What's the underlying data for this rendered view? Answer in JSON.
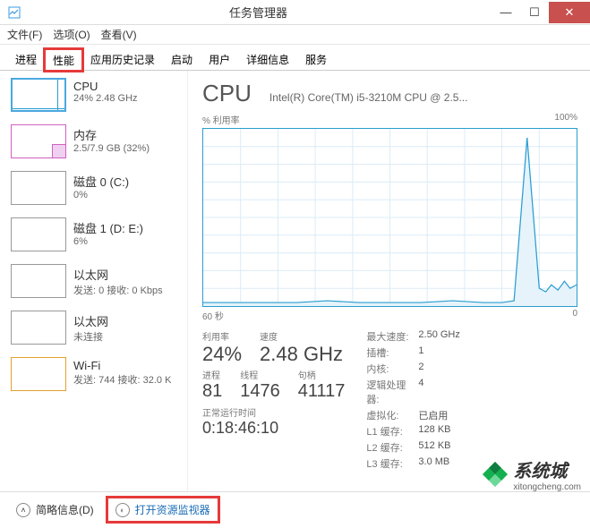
{
  "titlebar": {
    "title": "任务管理器"
  },
  "menu": {
    "file": "文件(F)",
    "options": "选项(O)",
    "view": "查看(V)"
  },
  "tabs": {
    "processes": "进程",
    "performance": "性能",
    "history": "应用历史记录",
    "startup": "启动",
    "users": "用户",
    "details": "详细信息",
    "services": "服务"
  },
  "sidebar": [
    {
      "name": "CPU",
      "sub": "24% 2.48 GHz"
    },
    {
      "name": "内存",
      "sub": "2.5/7.9 GB (32%)"
    },
    {
      "name": "磁盘 0 (C:)",
      "sub": "0%"
    },
    {
      "name": "磁盘 1 (D: E:)",
      "sub": "6%"
    },
    {
      "name": "以太网",
      "sub": "发送: 0 接收: 0 Kbps"
    },
    {
      "name": "以太网",
      "sub": "未连接"
    },
    {
      "name": "Wi-Fi",
      "sub": "发送: 744 接收: 32.0 K"
    }
  ],
  "cpu": {
    "title": "CPU",
    "model": "Intel(R) Core(TM) i5-3210M CPU @ 2.5...",
    "util_label": "% 利用率",
    "max_label": "100%",
    "time_label": "60 秒",
    "zero_label": "0",
    "labels": {
      "util": "利用率",
      "speed": "速度",
      "proc": "进程",
      "threads": "线程",
      "handles": "句柄",
      "maxspeed": "最大速度:",
      "sockets": "插槽:",
      "cores": "内核:",
      "lprocs": "逻辑处理器:",
      "virt": "虚拟化:",
      "l1": "L1 缓存:",
      "l2": "L2 缓存:",
      "l3": "L3 缓存:",
      "uptime": "正常运行时间"
    },
    "vals": {
      "util": "24%",
      "speed": "2.48 GHz",
      "proc": "81",
      "threads": "1476",
      "handles": "41117",
      "maxspeed": "2.50 GHz",
      "sockets": "1",
      "cores": "2",
      "lprocs": "4",
      "virt": "已启用",
      "l1": "128 KB",
      "l2": "512 KB",
      "l3": "3.0 MB",
      "uptime": "0:18:46:10"
    }
  },
  "footer": {
    "less": "简略信息(D)",
    "resmon": "打开资源监视器"
  },
  "watermark": {
    "text": "系统城",
    "url": "xitongcheng.com"
  },
  "chart_data": {
    "type": "line",
    "title": "% 利用率",
    "xlabel": "60 秒",
    "ylabel": "",
    "ylim": [
      0,
      100
    ],
    "x": [
      0,
      5,
      10,
      15,
      20,
      25,
      30,
      35,
      40,
      45,
      48,
      50,
      52,
      54,
      55,
      56,
      57,
      58,
      59,
      60
    ],
    "values": [
      2,
      2,
      2,
      2,
      3,
      2,
      2,
      2,
      3,
      2,
      2,
      3,
      95,
      10,
      8,
      12,
      9,
      14,
      10,
      12
    ]
  }
}
